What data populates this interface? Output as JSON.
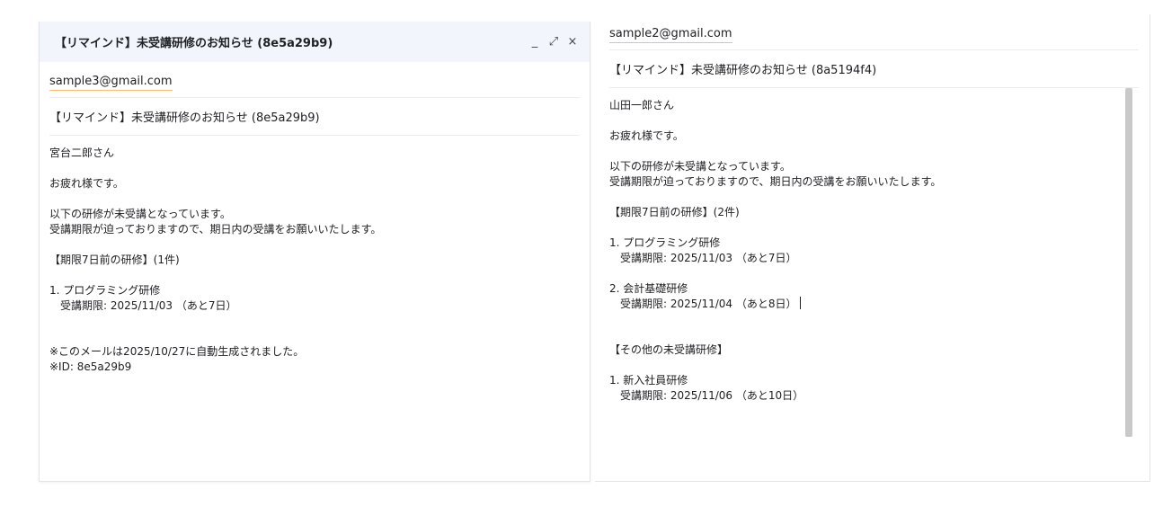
{
  "left": {
    "title": "【リマインド】未受講研修のお知らせ (8e5a29b9)",
    "to": "sample3@gmail.com",
    "subject": "【リマインド】未受講研修のお知らせ (8e5a29b9)",
    "body": {
      "greeting": "宮台二郎さん",
      "thanks": "お疲れ様です。",
      "notice1": "以下の研修が未受講となっています。",
      "notice2": "受講期限が迫っておりますので、期日内の受講をお願いいたします。",
      "section": "【期限7日前の研修】(1件)",
      "item1": "1. プログラミング研修",
      "item1_due": "受講期限: 2025/11/03 （あと7日）",
      "footer1": "※このメールは2025/10/27に自動生成されました。",
      "footer2": "※ID: 8e5a29b9"
    },
    "controls": {
      "minimize": "_",
      "expand": "⤢",
      "close": "×"
    }
  },
  "right": {
    "to": "sample2@gmail.com",
    "subject": "【リマインド】未受講研修のお知らせ (8a5194f4)",
    "body": {
      "greeting": "山田一郎さん",
      "thanks": "お疲れ様です。",
      "notice1": "以下の研修が未受講となっています。",
      "notice2": "受講期限が迫っておりますので、期日内の受講をお願いいたします。",
      "section": "【期限7日前の研修】(2件)",
      "item1": "1. プログラミング研修",
      "item1_due": "受講期限: 2025/11/03 （あと7日）",
      "item2": "2. 会計基礎研修",
      "item2_due": "受講期限: 2025/11/04 （あと8日）",
      "section2": "【その他の未受講研修】",
      "item3": "1. 新入社員研修",
      "item3_due": "受講期限: 2025/11/06 （あと10日）"
    }
  }
}
